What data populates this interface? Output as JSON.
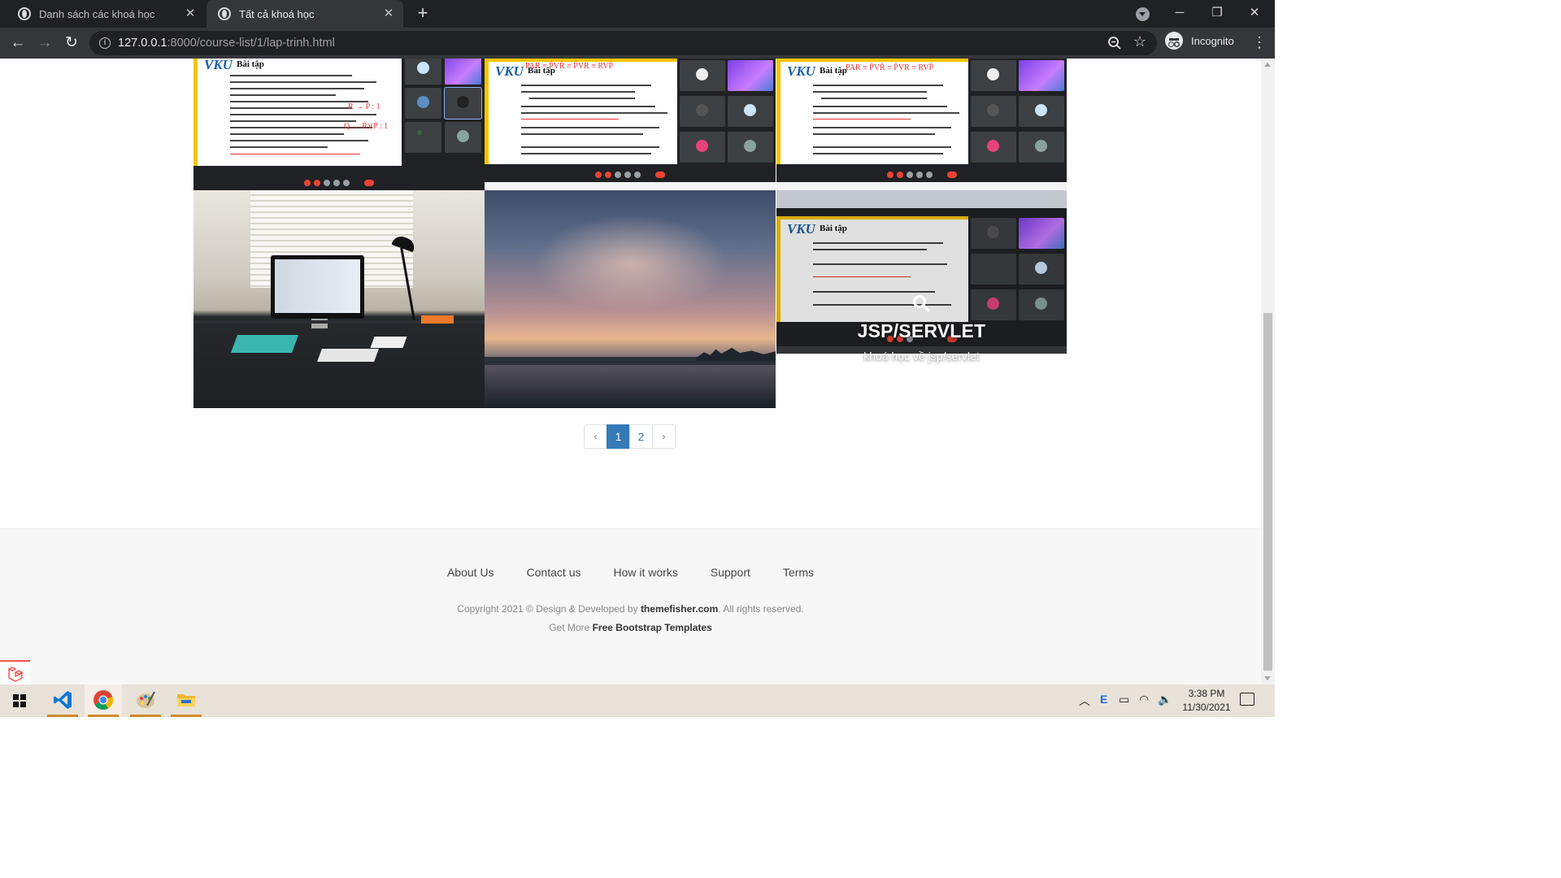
{
  "browser": {
    "tabs": [
      {
        "title": "Danh sách các khoá học",
        "active": false
      },
      {
        "title": "Tất cả khoá học",
        "active": true
      }
    ],
    "url_host": "127.0.0.1",
    "url_rest": ":8000/course-list/1/lap-trinh.html",
    "profile_label": "Incognito"
  },
  "gallery": {
    "slide_heading": "Bài tập",
    "slide_brand": "VKU",
    "hover_title": "JSP/SERVLET",
    "hover_subtitle": "khoá học về jsp/servlet"
  },
  "pagination": {
    "prev": "‹",
    "pages": [
      "1",
      "2"
    ],
    "current": "1",
    "next": "›"
  },
  "footer": {
    "links": [
      "About Us",
      "Contact us",
      "How it works",
      "Support",
      "Terms"
    ],
    "copyright_prefix": "Copyright 2021 © Design & Developed by ",
    "copyright_brand": "themefisher.com",
    "copyright_suffix": ". All rights reserved.",
    "getmore_prefix": "Get More ",
    "getmore_link": "Free Bootstrap Templates"
  },
  "taskbar": {
    "time": "3:38 PM",
    "date": "11/30/2021"
  },
  "colors": {
    "accent": "#337ab7",
    "chrome_dark": "#202124",
    "footer_bg": "#f7f7f7"
  }
}
